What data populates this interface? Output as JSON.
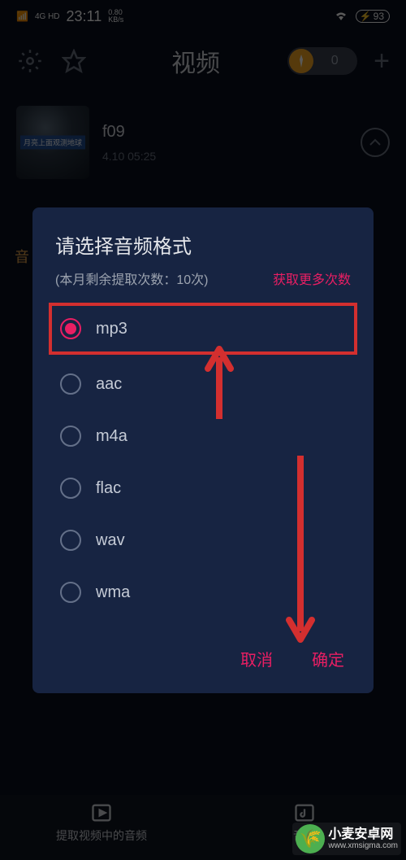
{
  "status": {
    "signal_label": "4G HD",
    "time": "23:11",
    "net_speed": "0.80\nKB/s",
    "battery": "93"
  },
  "header": {
    "title": "视频",
    "coin_count": "0"
  },
  "video_item": {
    "thumb_caption": "月亮上面观测地球",
    "name": "f09",
    "meta": "4.10       05:25"
  },
  "side_tab": "音",
  "dialog": {
    "title": "请选择音频格式",
    "subtitle": "(本月剩余提取次数：10次)",
    "link": "获取更多次数",
    "options": [
      "mp3",
      "aac",
      "m4a",
      "flac",
      "wav",
      "wma"
    ],
    "selected_index": 0,
    "cancel": "取消",
    "confirm": "确定"
  },
  "bottom": {
    "tab1": "提取视频中的音频",
    "tab2": "音频"
  },
  "watermark": {
    "main": "小麦安卓网",
    "sub": "www.xmsigma.com"
  }
}
